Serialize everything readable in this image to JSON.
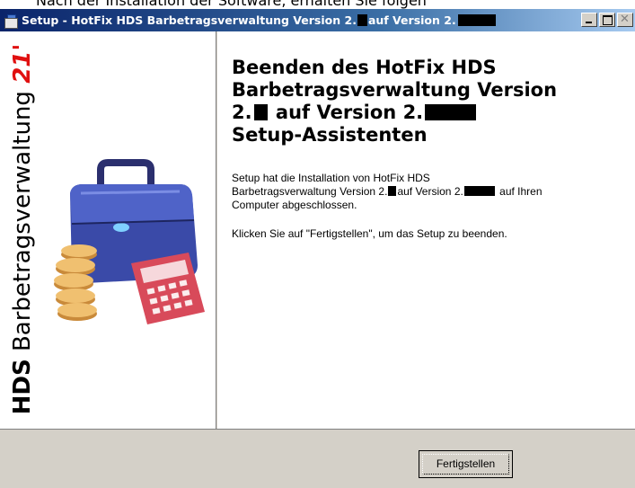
{
  "background_strip": {
    "text": "Nach der Installation der Software, erhalten Sie folgen"
  },
  "window": {
    "title_prefix": "Setup - HotFix HDS Barbetragsverwaltung Version 2.",
    "title_middle": " auf Version 2.",
    "controls": {
      "minimize": "_",
      "maximize": "□",
      "close": "✕"
    }
  },
  "sidebar": {
    "brand_hds": "HDS",
    "brand_name": " Barbetragsverwaltung ",
    "brand_year": "21'",
    "illustration_icon": "briefcase-coins-calculator"
  },
  "main": {
    "heading": {
      "line1": "Beenden des HotFix HDS",
      "line2": "Barbetragsverwaltung Version",
      "line3_a": "2.",
      "line3_b": " auf Version 2.",
      "line4": "Setup-Assistenten"
    },
    "paragraph1": {
      "part1": "Setup hat die Installation von HotFix HDS",
      "part2": "Barbetragsverwaltung Version 2.",
      "part3": "auf Version 2.",
      "part4": " auf Ihren",
      "part5": "Computer abgeschlossen."
    },
    "paragraph2": "Klicken Sie auf \"Fertigstellen\", um das Setup zu beenden."
  },
  "footer": {
    "finish_button": "Fertigstellen"
  },
  "colors": {
    "titlebar_start": "#0a246a",
    "titlebar_end": "#a6caf0",
    "face": "#d4d0c8",
    "brand_red": "#e01010"
  }
}
